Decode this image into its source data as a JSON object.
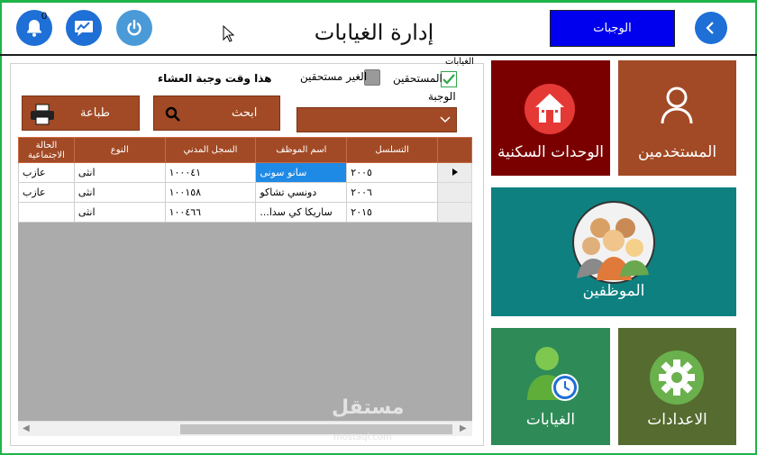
{
  "header": {
    "title": "إدارة الغيابات",
    "notification_count": "0",
    "meals_button": "الوجبات",
    "icons": [
      "bell-icon",
      "chart-chat-icon",
      "power-icon",
      "chevron-left-icon"
    ]
  },
  "filters": {
    "group_caption": "الغيابات",
    "eligible_label": "المستحقين",
    "eligible_checked": true,
    "not_eligible_label": "الغير مستحقين",
    "not_eligible_checked": false,
    "dinner_time_label": "هذا وقت وجبة العشاء",
    "meal_label": "الوجبة",
    "meal_value": ""
  },
  "actions": {
    "search_label": "ابحث",
    "print_label": "طباعة"
  },
  "grid": {
    "columns": [
      "الحالة الاجتماعية",
      "النوع",
      "السجل المدني",
      "اسم الموظف",
      "التسلسل"
    ],
    "rows": [
      {
        "marital": "عازب",
        "gender": "انثى",
        "civil_id": "١٠٠٠٤١",
        "name": "سانو سونى",
        "seq": "٢٠٠٥",
        "selected": true
      },
      {
        "marital": "عازب",
        "gender": "انثى",
        "civil_id": "١٠٠١٥٨",
        "name": "دونسي تشاكو",
        "seq": "٢٠٠٦",
        "selected": false
      },
      {
        "marital": "",
        "gender": "انثى",
        "civil_id": "١٠٠٤٦٦",
        "name": "ساريكا كي سدا...",
        "seq": "٢٠١٥",
        "selected": false
      }
    ]
  },
  "tiles": {
    "users": "المستخدمين",
    "housing": "الوحدات السكنية",
    "employees": "الموظفين",
    "settings": "الاعدادات",
    "absences": "الغيابات"
  },
  "colors": {
    "accent_blue": "#1e6fd6",
    "brown": "#a24a25",
    "dark_red": "#7a0000",
    "teal": "#0e8080",
    "green": "#2e8b57",
    "olive": "#556b2f",
    "window_border": "#1fb34a"
  },
  "watermark": {
    "text": "مستقل",
    "url": "mostaql.com"
  }
}
